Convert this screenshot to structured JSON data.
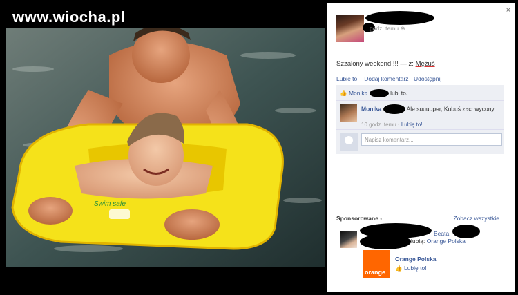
{
  "watermark": "www.wiocha.pl",
  "photo": {
    "float_text": "Swim safe"
  },
  "post": {
    "close_label": "×",
    "timestamp": "godz. temu",
    "status_text": "Szzalony weekend !!! — z: ",
    "tagged_name": "Mężuś",
    "actions": [
      "Lubię to!",
      "Dodaj komentarz",
      "Udostępnij"
    ],
    "likes": {
      "name": "Monika",
      "suffix": "lubi to."
    },
    "comment": {
      "author": "Monika",
      "text": "Ale suuuuper, Kubuś zachwycony",
      "time": "10 godz. temu",
      "like_label": "Lubię to!"
    },
    "write_placeholder": "Napisz komentarz..."
  },
  "sponsored": {
    "title": "Sponsorowane",
    "see_all": "Zobacz wszystkie",
    "friend": "Beata",
    "likes_text": "lubią: ",
    "page_link": "Orange Polska",
    "ad_name": "Orange Polska",
    "ad_like": "Lubię to!",
    "logo_text": "orange"
  },
  "colors": {
    "link": "#3b5998",
    "orange": "#ff6600",
    "float_yellow": "#f5e21a"
  }
}
